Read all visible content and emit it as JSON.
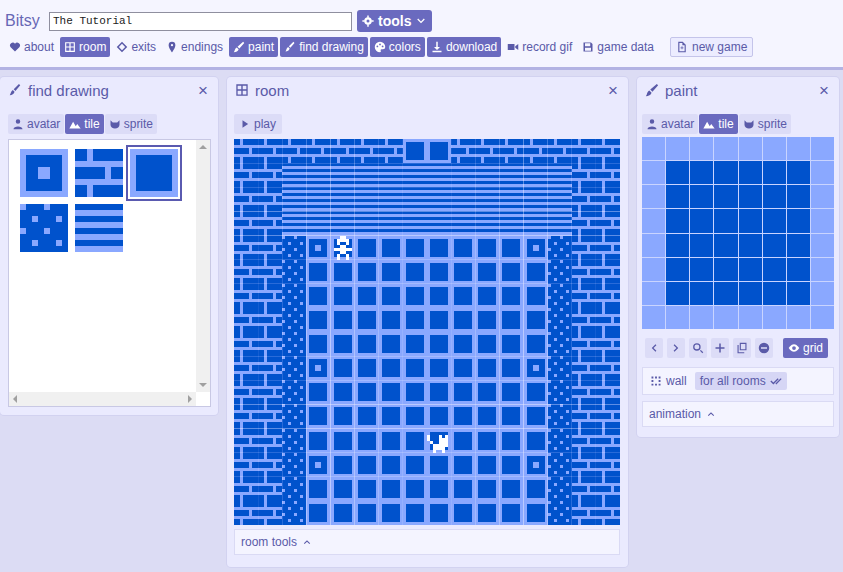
{
  "app": {
    "name": "Bitsy"
  },
  "title_field": {
    "value": "The Tutorial"
  },
  "tools_button": {
    "label": "tools"
  },
  "nav": [
    {
      "label": "about",
      "selected": false
    },
    {
      "label": "room",
      "selected": true
    },
    {
      "label": "exits",
      "selected": false
    },
    {
      "label": "endings",
      "selected": false
    },
    {
      "label": "paint",
      "selected": true
    },
    {
      "label": "find drawing",
      "selected": true
    },
    {
      "label": "colors",
      "selected": true
    },
    {
      "label": "download",
      "selected": true
    },
    {
      "label": "record gif",
      "selected": false
    },
    {
      "label": "game data",
      "selected": false
    }
  ],
  "new_game_button": {
    "label": "new game"
  },
  "find_drawing": {
    "title": "find drawing",
    "close": "×",
    "tabs": [
      {
        "label": "avatar",
        "selected": false
      },
      {
        "label": "tile",
        "selected": true
      },
      {
        "label": "sprite",
        "selected": false
      }
    ],
    "tiles": [
      {
        "selected": false
      },
      {
        "selected": false
      },
      {
        "selected": true
      },
      {
        "selected": false
      },
      {
        "selected": false
      }
    ]
  },
  "room": {
    "title": "room",
    "close": "×",
    "play_button": {
      "label": "play"
    },
    "map": [
      "1111111221111111",
      "1144444444444411",
      "1144444444444411",
      "1144444444444411",
      "1130222222220311",
      "1132222222222311",
      "1132222222222311",
      "1132222222222311",
      "1132222222222311",
      "1130222222220311",
      "1132222222222311",
      "1132222222222311",
      "1132222222222311",
      "1130222222220311",
      "1132222222222311",
      "1132222222222311"
    ],
    "sprites": [
      {
        "col": 4,
        "row": 4
      }
    ],
    "avatar": {
      "col": 8,
      "row": 12
    },
    "tools": {
      "label": "room tools",
      "expanded": false
    }
  },
  "paint": {
    "title": "paint",
    "close": "×",
    "tabs": [
      {
        "label": "avatar",
        "selected": false
      },
      {
        "label": "tile",
        "selected": true
      },
      {
        "label": "sprite",
        "selected": false
      }
    ],
    "canvas_grid": {
      "label": "grid",
      "selected": true
    },
    "wall": {
      "label": "wall",
      "checked": false
    },
    "wall_scope": {
      "label": "for all rooms"
    },
    "animation": {
      "label": "animation",
      "expanded": false
    }
  }
}
